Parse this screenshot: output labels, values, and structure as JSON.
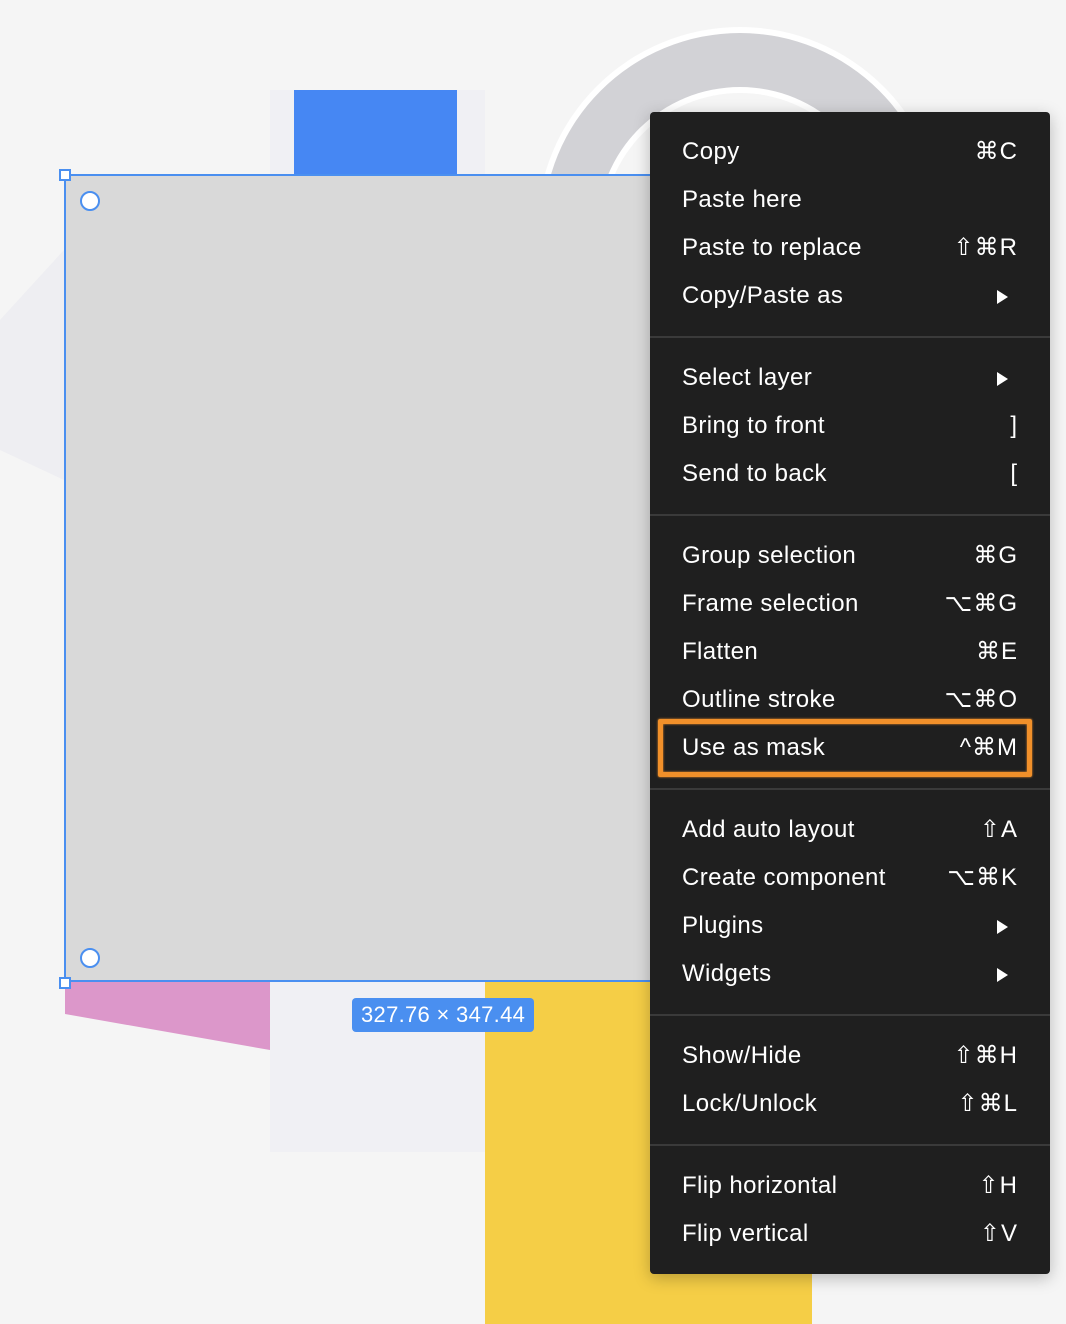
{
  "canvas": {
    "selection": {
      "dimensions_label": "327.76 × 347.44",
      "selection_color": "#4a8ff0",
      "fill_color": "#d9d9d9"
    },
    "artwork_colors": {
      "blue": "#4687f3",
      "yellow": "#f5ce46",
      "pink": "#dc97ca",
      "ring_gray": "#d2d2d6",
      "pale_panel": "#f0f0f4"
    }
  },
  "context_menu": {
    "sections": [
      {
        "items": [
          {
            "label": "Copy",
            "shortcut": "⌘C"
          },
          {
            "label": "Paste here",
            "shortcut": ""
          },
          {
            "label": "Paste to replace",
            "shortcut": "⇧⌘R"
          },
          {
            "label": "Copy/Paste as",
            "submenu": true
          }
        ]
      },
      {
        "items": [
          {
            "label": "Select layer",
            "submenu": true
          },
          {
            "label": "Bring to front",
            "shortcut": "]"
          },
          {
            "label": "Send to back",
            "shortcut": "["
          }
        ]
      },
      {
        "items": [
          {
            "label": "Group selection",
            "shortcut": "⌘G"
          },
          {
            "label": "Frame selection",
            "shortcut": "⌥⌘G"
          },
          {
            "label": "Flatten",
            "shortcut": "⌘E"
          },
          {
            "label": "Outline stroke",
            "shortcut": "⌥⌘O"
          },
          {
            "label": "Use as mask",
            "shortcut": "^⌘M",
            "highlighted": true
          }
        ]
      },
      {
        "items": [
          {
            "label": "Add auto layout",
            "shortcut": "⇧A"
          },
          {
            "label": "Create component",
            "shortcut": "⌥⌘K"
          },
          {
            "label": "Plugins",
            "submenu": true
          },
          {
            "label": "Widgets",
            "submenu": true
          }
        ]
      },
      {
        "items": [
          {
            "label": "Show/Hide",
            "shortcut": "⇧⌘H"
          },
          {
            "label": "Lock/Unlock",
            "shortcut": "⇧⌘L"
          }
        ]
      },
      {
        "items": [
          {
            "label": "Flip horizontal",
            "shortcut": "⇧H"
          },
          {
            "label": "Flip vertical",
            "shortcut": "⇧V"
          }
        ]
      }
    ],
    "highlight_color": "#f1902a",
    "background_color": "#1f1f1f"
  }
}
